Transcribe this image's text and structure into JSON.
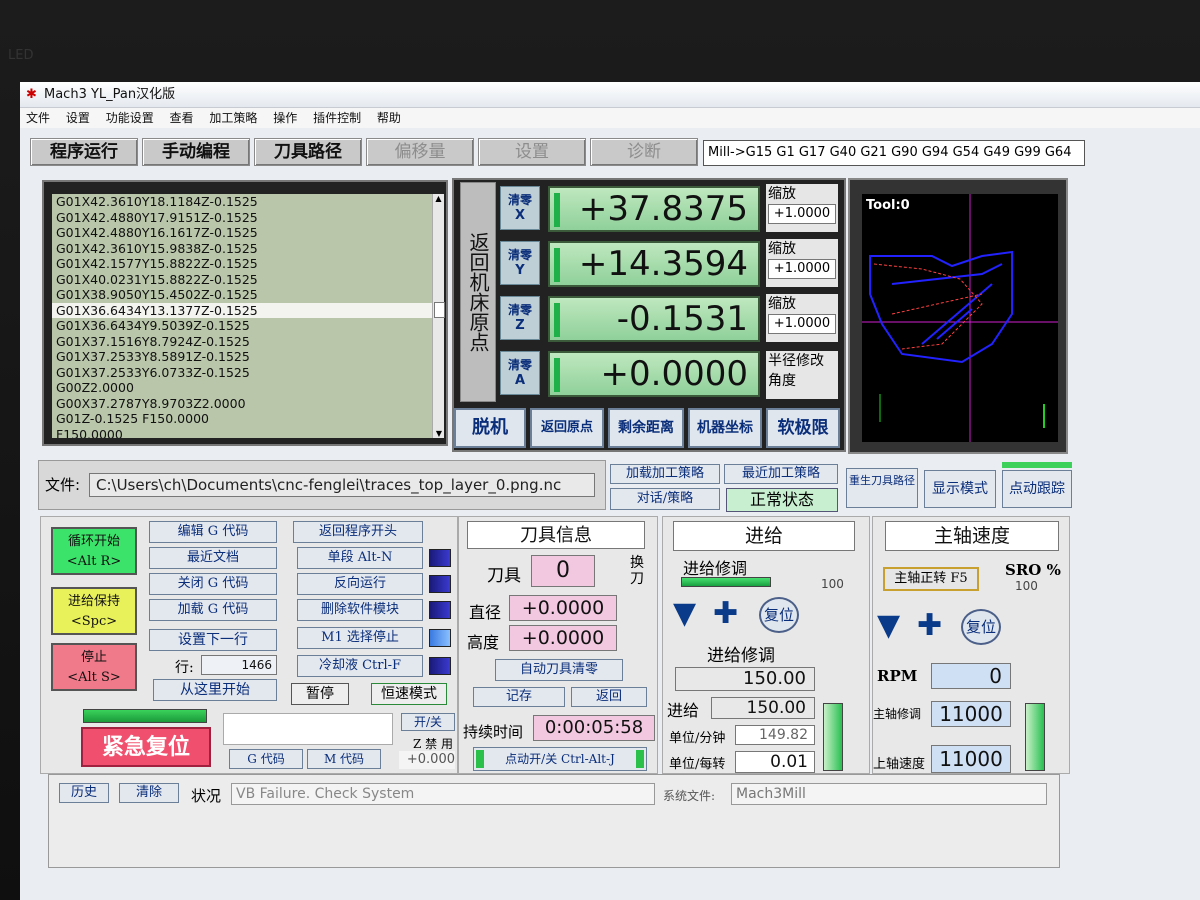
{
  "window": {
    "title": "Mach3 YL_Pan汉化版"
  },
  "menu": [
    "文件",
    "设置",
    "功能设置",
    "查看",
    "加工策略",
    "操作",
    "插件控制",
    "帮助"
  ],
  "tabs": [
    {
      "label": "程序运行",
      "active": true
    },
    {
      "label": "手动编程",
      "active": true
    },
    {
      "label": "刀具路径",
      "active": true
    },
    {
      "label": "偏移量",
      "active": false
    },
    {
      "label": "设置",
      "active": false
    },
    {
      "label": "诊断",
      "active": false
    }
  ],
  "modal_line": "Mill->G15  G1 G17 G40 G21 G90 G94 G54 G49 G99 G64",
  "gcode": {
    "lines": [
      "G01X42.3610Y18.1184Z-0.1525",
      "G01X42.4880Y17.9151Z-0.1525",
      "G01X42.4880Y16.1617Z-0.1525",
      "G01X42.3610Y15.9838Z-0.1525",
      "G01X42.1577Y15.8822Z-0.1525",
      "G01X40.0231Y15.8822Z-0.1525",
      "G01X38.9050Y15.4502Z-0.1525",
      "G01X36.6434Y13.1377Z-0.1525",
      "G01X36.6434Y9.5039Z-0.1525",
      "G01X37.1516Y8.7924Z-0.1525",
      "G01X37.2533Y8.5891Z-0.1525",
      "G01X37.2533Y6.0733Z-0.1525",
      "G00Z2.0000",
      "G00X37.2787Y8.9703Z2.0000",
      "G01Z-0.1525 F150.0000",
      "F150.0000"
    ],
    "selected_index": 7
  },
  "dro": {
    "title": "返回机床原点",
    "axes": [
      {
        "zero_label": "清零",
        "axis": "X",
        "value": "+37.8375",
        "scale_label": "缩放",
        "scale": "+1.0000"
      },
      {
        "zero_label": "清零",
        "axis": "Y",
        "value": "+14.3594",
        "scale_label": "缩放",
        "scale": "+1.0000"
      },
      {
        "zero_label": "清零",
        "axis": "Z",
        "value": "-0.1531",
        "scale_label": "缩放",
        "scale": "+1.0000"
      },
      {
        "zero_label": "清零",
        "axis": "A",
        "value": "+0.0000",
        "scale_label": "半径修改",
        "scale": "角度"
      }
    ],
    "buttons": [
      "脱机",
      "返回原点",
      "剩余距离",
      "机器坐标",
      "软极限"
    ]
  },
  "toolpath": {
    "label": "Tool:0"
  },
  "file": {
    "label": "文件:",
    "path": "C:\\Users\\ch\\Documents\\cnc-fenglei\\traces_top_layer_0.png.nc"
  },
  "strategy": {
    "load": "加载加工策略",
    "recent": "最近加工策略",
    "dialog": "对话/策略",
    "status": "正常状态"
  },
  "right_buttons": {
    "regen": "重生刀具路径",
    "display": "显示模式",
    "jog": "点动跟踪"
  },
  "program": {
    "cycle_start": "循环开始\n<Alt R>",
    "feed_hold": "进给保持\n<Spc>",
    "stop": "停止\n<Alt S>",
    "edit": "编辑 G 代码",
    "recent": "最近文档",
    "close": "关闭 G 代码",
    "load": "加载 G 代码",
    "set_next": "设置下一行",
    "line_label": "行:",
    "line_value": "1466",
    "run_from": "从这里开始",
    "rewind": "返回程序开头",
    "single": "单段 Alt-N",
    "reverse": "反向运行",
    "block_del": "删除软件模块",
    "m1": "M1 选择停止",
    "coolant": "冷却液 Ctrl-F",
    "pause": "暂停",
    "const_vel": "恒速模式",
    "reset": "紧急复位",
    "onoff": "开/关",
    "z_inhibit": "Z 禁 用",
    "z_inhibit_value": "+0.000",
    "gcodes": "G 代码",
    "mcodes": "M 代码"
  },
  "tool": {
    "title": "刀具信息",
    "tool_label": "刀具",
    "tool_value": "0",
    "change": "换刀",
    "dia_label": "直径",
    "dia_value": "+0.0000",
    "height_label": "高度",
    "height_value": "+0.0000",
    "auto_zero": "自动刀具清零",
    "remember": "记存",
    "return": "返回",
    "elapsed_label": "持续时间",
    "elapsed": "0:00:05:58",
    "jog_toggle": "点动开/关 Ctrl-Alt-J"
  },
  "feed": {
    "title": "进给",
    "fro_label": "进给修调",
    "fro_pct": "100",
    "reset": "复位",
    "fro2_label": "进给修调",
    "fro_value": "150.00",
    "feed_label": "进给",
    "feed_value": "150.00",
    "upm_label": "单位/分钟",
    "upm_value": "149.82",
    "upr_label": "单位/每转",
    "upr_value": "0.01"
  },
  "spindle": {
    "title": "主轴速度",
    "cw": "主轴正转 F5",
    "sro_label": "SRO %",
    "sro_value": "100",
    "reset": "复位",
    "rpm_label": "RPM",
    "rpm_value": "0",
    "so_label": "主轴修调",
    "so_value": "11000",
    "ss_label": "上轴速度",
    "ss_value": "11000"
  },
  "statusbar": {
    "history": "历史",
    "clear": "清除",
    "status_label": "状况",
    "status": "VB Failure. Check System",
    "profile_label": "系统文件:",
    "profile": "Mach3Mill"
  }
}
